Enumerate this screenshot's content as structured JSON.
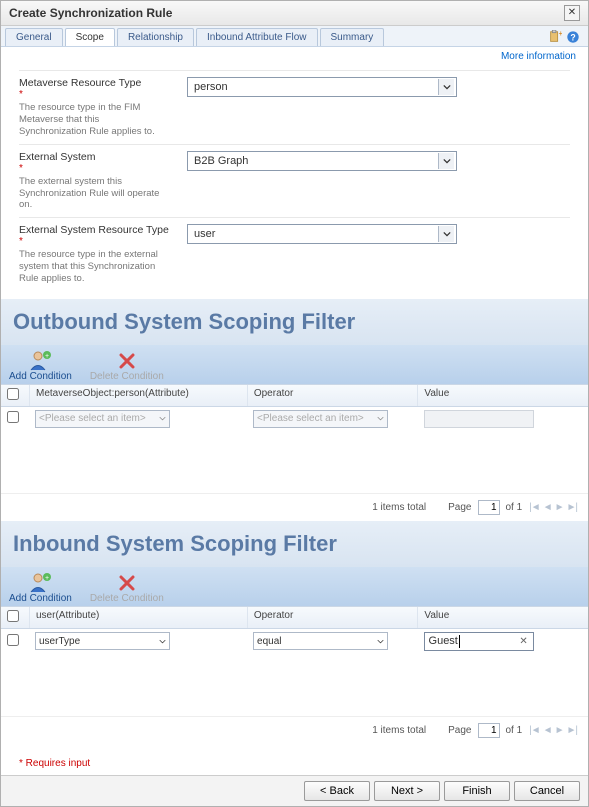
{
  "dialog": {
    "title": "Create Synchronization Rule"
  },
  "tabs": [
    "General",
    "Scope",
    "Relationship",
    "Inbound Attribute Flow",
    "Summary"
  ],
  "active_tab": "Scope",
  "info_link": "More information",
  "fields": {
    "metaverse_type": {
      "label": "Metaverse Resource Type",
      "desc": "The resource type in the FIM Metaverse that this Synchronization Rule applies to.",
      "value": "person"
    },
    "external_system": {
      "label": "External System",
      "desc": "The external system this Synchronization Rule will operate on.",
      "value": "B2B Graph"
    },
    "external_type": {
      "label": "External System Resource Type",
      "desc": "The resource type in the external system that this Synchronization Rule applies to.",
      "value": "user"
    }
  },
  "outbound": {
    "title": "Outbound System Scoping Filter",
    "add_label": "Add Condition",
    "delete_label": "Delete Condition",
    "cols": {
      "attr": "MetaverseObject:person(Attribute)",
      "op": "Operator",
      "val": "Value"
    },
    "row": {
      "attr_placeholder": "<Please select an item>",
      "op_placeholder": "<Please select an item>"
    },
    "pager": {
      "total": "1 items total",
      "page_label": "Page",
      "page": "1",
      "of": "of 1"
    }
  },
  "inbound": {
    "title": "Inbound System Scoping Filter",
    "add_label": "Add Condition",
    "delete_label": "Delete Condition",
    "cols": {
      "attr": "user(Attribute)",
      "op": "Operator",
      "val": "Value"
    },
    "row": {
      "attr": "userType",
      "op": "equal",
      "val": "Guest"
    },
    "pager": {
      "total": "1 items total",
      "page_label": "Page",
      "page": "1",
      "of": "of 1"
    }
  },
  "footer_note": "* Requires input",
  "buttons": {
    "back": "< Back",
    "next": "Next >",
    "finish": "Finish",
    "cancel": "Cancel"
  }
}
